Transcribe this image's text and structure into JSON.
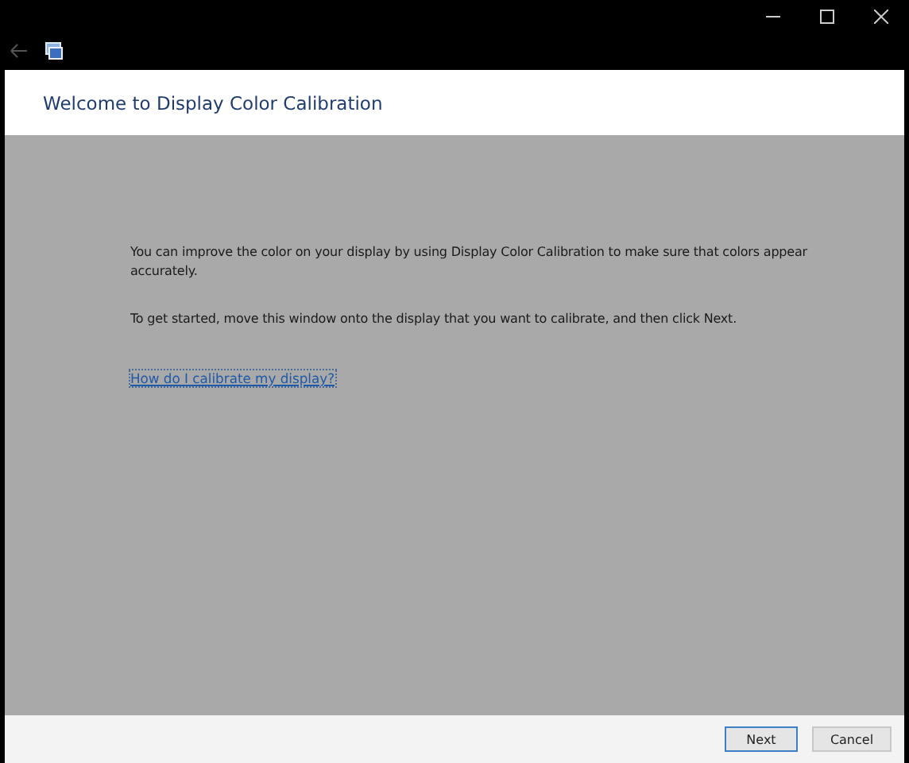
{
  "header": {
    "title": "Welcome to Display Color Calibration"
  },
  "body": {
    "paragraphs": [
      "You can improve the color on your display by using Display Color Calibration to make sure that colors appear accurately.",
      "To get started, move this window onto the display that you want to calibrate, and then click Next."
    ],
    "link": "How do I calibrate my display?"
  },
  "buttons": [
    {
      "label": "Next",
      "focused": true
    },
    {
      "label": "Cancel",
      "focused": false
    }
  ]
}
